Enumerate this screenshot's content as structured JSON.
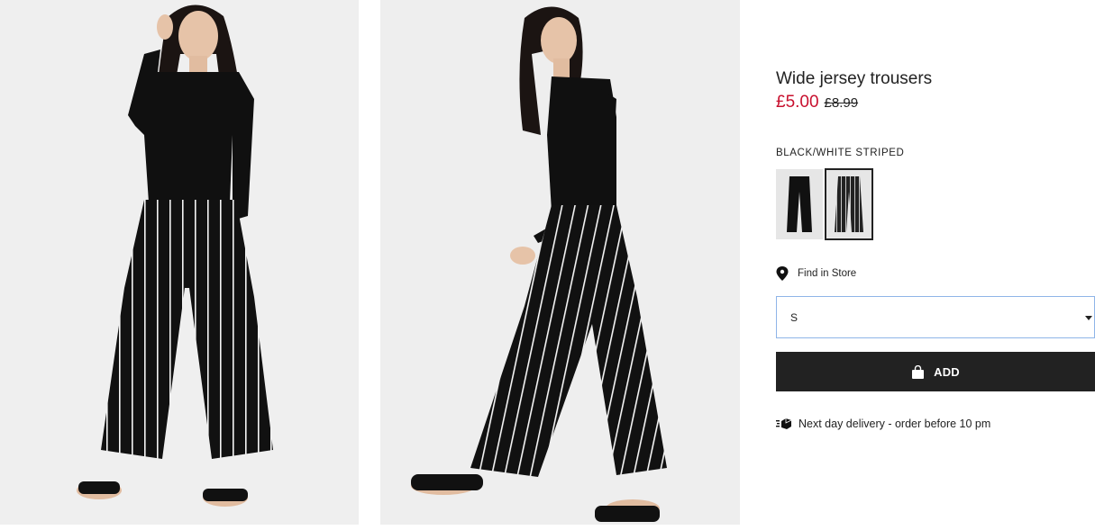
{
  "product": {
    "name": "Wide jersey trousers",
    "price_sale": "£5.00",
    "price_original": "£8.99"
  },
  "color": {
    "selected_label": "BLACK/WHITE STRIPED",
    "swatches": [
      {
        "name": "Black",
        "selected": false
      },
      {
        "name": "Black/White striped",
        "selected": true
      }
    ]
  },
  "store": {
    "find_label": "Find in Store"
  },
  "size": {
    "selected_value": "S"
  },
  "cart": {
    "add_label": "ADD"
  },
  "delivery": {
    "text": "Next day delivery - order before 10 pm"
  },
  "colors": {
    "sale_red": "#c8102e",
    "button_bg": "#222222",
    "select_border": "#8fb5e8"
  },
  "icons": {
    "location": "pin-icon",
    "bag": "shopping-bag-icon",
    "delivery": "delivery-truck-icon",
    "dropdown": "chevron-down-icon"
  }
}
